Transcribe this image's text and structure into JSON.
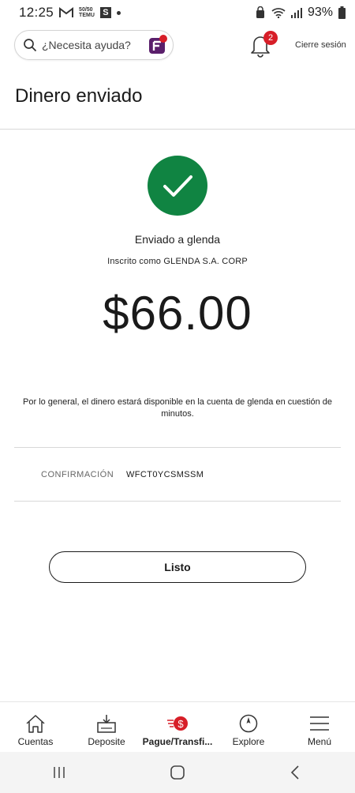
{
  "status_bar": {
    "time": "12:25",
    "badge_line1": "50/50",
    "badge_line2": "TEMU",
    "s_app": "S",
    "battery": "93%"
  },
  "header": {
    "search_placeholder": "¿Necesita ayuda?",
    "notifications_count": "2",
    "logout_label": "Cierre sesión"
  },
  "page": {
    "title": "Dinero enviado",
    "sent_to": "Enviado a glenda",
    "registered_as": "Inscrito como GLENDA S.A. CORP",
    "amount": "$66.00",
    "note": "Por lo general, el dinero estará disponible en la cuenta de glenda en cuestión de minutos.",
    "confirmation_label": "CONFIRMACIÓN",
    "confirmation_value": "WFCT0YCSMSSM",
    "done_button": "Listo"
  },
  "bottom_nav": [
    {
      "label": "Cuentas",
      "icon": "house-icon"
    },
    {
      "label": "Deposite",
      "icon": "deposit-icon"
    },
    {
      "label": "Pague/Transfi...",
      "icon": "pay-transfer-icon",
      "active": true
    },
    {
      "label": "Explore",
      "icon": "compass-icon"
    },
    {
      "label": "Menú",
      "icon": "hamburger-icon"
    }
  ],
  "colors": {
    "success_green": "#108442",
    "brand_red": "#d71e28",
    "fargo_purple": "#5a1f6b"
  }
}
